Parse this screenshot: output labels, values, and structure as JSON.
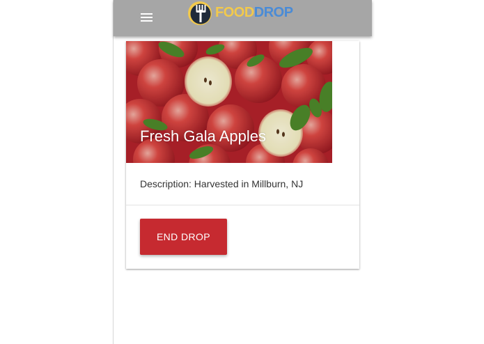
{
  "app": {
    "logo": {
      "part1": "FOOD",
      "part2": "DROP",
      "colors": {
        "food": "#f2c94c",
        "drop": "#4a8bd6",
        "icon_ring": "#f2c94c",
        "icon_fill": "#2b2b2b"
      }
    },
    "menu_icon": "hamburger-menu-icon",
    "appbar_color": "#a6a6a6"
  },
  "card": {
    "title": "Fresh Gala Apples",
    "image": "apples-photo",
    "description": "Description: Harvested in Millburn, NJ",
    "action_label": "END DROP",
    "action_color": "#c62a30"
  }
}
